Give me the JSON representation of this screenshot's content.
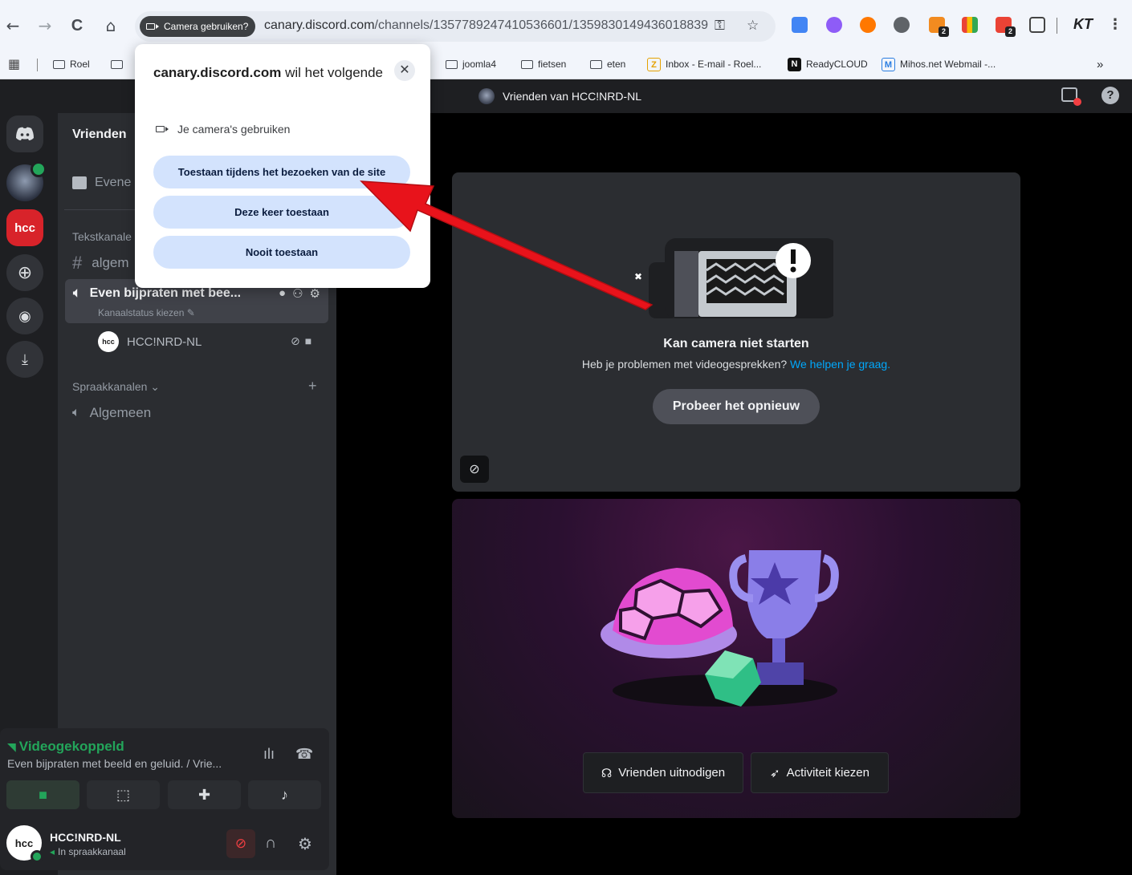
{
  "browser": {
    "nav": {
      "back": "←",
      "forward": "→",
      "reload": "C",
      "home": "⌂"
    },
    "permission_chip": "Camera gebruiken?",
    "url_host": "canary.discord.com",
    "url_path": "/channels/1357789247410536601/1359830149436018839",
    "extensions": [
      {
        "name": "translate-extension-icon",
        "color": "#4285f4"
      },
      {
        "name": "puzzle-gear-extension-icon",
        "color": "#8e5cf7"
      },
      {
        "name": "avast-extension-icon",
        "color": "#ff7800"
      },
      {
        "name": "recycle-extension-icon",
        "color": "#5f6368"
      },
      {
        "name": "orange-extension-icon",
        "color": "#f28b20",
        "badge": "2"
      },
      {
        "name": "colorgrid-extension-icon",
        "color": "#fbbc04"
      },
      {
        "name": "red-extension-icon",
        "color": "#ea4335",
        "badge": "2"
      }
    ],
    "profile_label": "KT",
    "menu": "⋮"
  },
  "bookmarks": {
    "items": [
      {
        "label": "Roel",
        "type": "folder"
      },
      {
        "label": "joomla4",
        "type": "folder"
      },
      {
        "label": "fietsen",
        "type": "folder"
      },
      {
        "label": "eten",
        "type": "folder"
      },
      {
        "label": "Inbox - E-mail - Roel...",
        "type": "zoho"
      },
      {
        "label": "ReadyCLOUD",
        "type": "netgear"
      },
      {
        "label": "Mihos.net Webmail -...",
        "type": "webmail"
      }
    ],
    "more": "»"
  },
  "popup": {
    "host": "canary.discord.com",
    "title_rest": "wil het volgende",
    "permission": "Je camera's gebruiken",
    "btn_allow_site": "Toestaan tijdens het bezoeken van de site",
    "btn_allow_once": "Deze keer toestaan",
    "btn_never": "Nooit toestaan",
    "close": "✕"
  },
  "discord": {
    "header_title": "Vrienden van HCC!NRD-NL",
    "server_name": "Vrienden",
    "events_label": "Evene",
    "text_category": "Tekstkanale",
    "text_channel": "algem",
    "active_voice_channel": "Even bijpraten met bee...",
    "channel_status": "Kanaalstatus kiezen",
    "member_name": "HCC!NRD-NL",
    "voice_category": "Spraakkanalen",
    "voice_channel": "Algemeen",
    "add_channel": "+",
    "voice_status": "Videogekoppeld",
    "voice_status_channel": "Even bijpraten met beeld en geluid. / Vrie...",
    "user_name": "HCC!NRD-NL",
    "user_status": "In spraakkanaal",
    "logo_text": "hcc"
  },
  "main": {
    "cam_error_title": "Kan camera niet starten",
    "cam_error_sub": "Heb je problemen met videogesprekken?",
    "cam_error_link": "We helpen je graag.",
    "retry_button": "Probeer het opnieuw",
    "invite_button": "Vrienden uitnodigen",
    "activity_button": "Activiteit kiezen"
  },
  "colors": {
    "discord_bg": "#313338",
    "accent_green": "#23a55a",
    "link_blue": "#00a8fc",
    "popup_button": "#d3e3fd",
    "annotation_arrow": "#e8131b"
  }
}
